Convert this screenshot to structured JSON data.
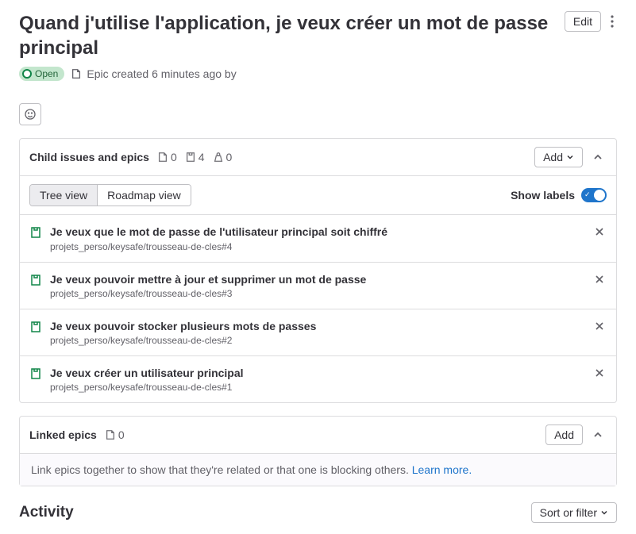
{
  "header": {
    "title": "Quand j'utilise l'application, je veux créer un mot de passe principal",
    "edit_label": "Edit"
  },
  "status": {
    "badge": "Open",
    "meta": "Epic created 6 minutes ago by"
  },
  "children": {
    "title": "Child issues and epics",
    "counts": {
      "epics": "0",
      "issues": "4",
      "weight": "0"
    },
    "add_label": "Add",
    "views": {
      "tree": "Tree view",
      "roadmap": "Roadmap view"
    },
    "show_labels": "Show labels",
    "items": [
      {
        "title": "Je veux que le mot de passe de l'utilisateur principal soit chiffré",
        "path": "projets_perso/keysafe/trousseau-de-cles#4"
      },
      {
        "title": "Je veux pouvoir mettre à jour et supprimer un mot de passe",
        "path": "projets_perso/keysafe/trousseau-de-cles#3"
      },
      {
        "title": "Je veux pouvoir stocker plusieurs mots de passes",
        "path": "projets_perso/keysafe/trousseau-de-cles#2"
      },
      {
        "title": "Je veux créer un utilisateur principal",
        "path": "projets_perso/keysafe/trousseau-de-cles#1"
      }
    ]
  },
  "linked": {
    "title": "Linked epics",
    "count": "0",
    "add_label": "Add",
    "help_text": "Link epics together to show that they're related or that one is blocking others. ",
    "learn_more": "Learn more."
  },
  "activity": {
    "title": "Activity",
    "sort_label": "Sort or filter"
  }
}
